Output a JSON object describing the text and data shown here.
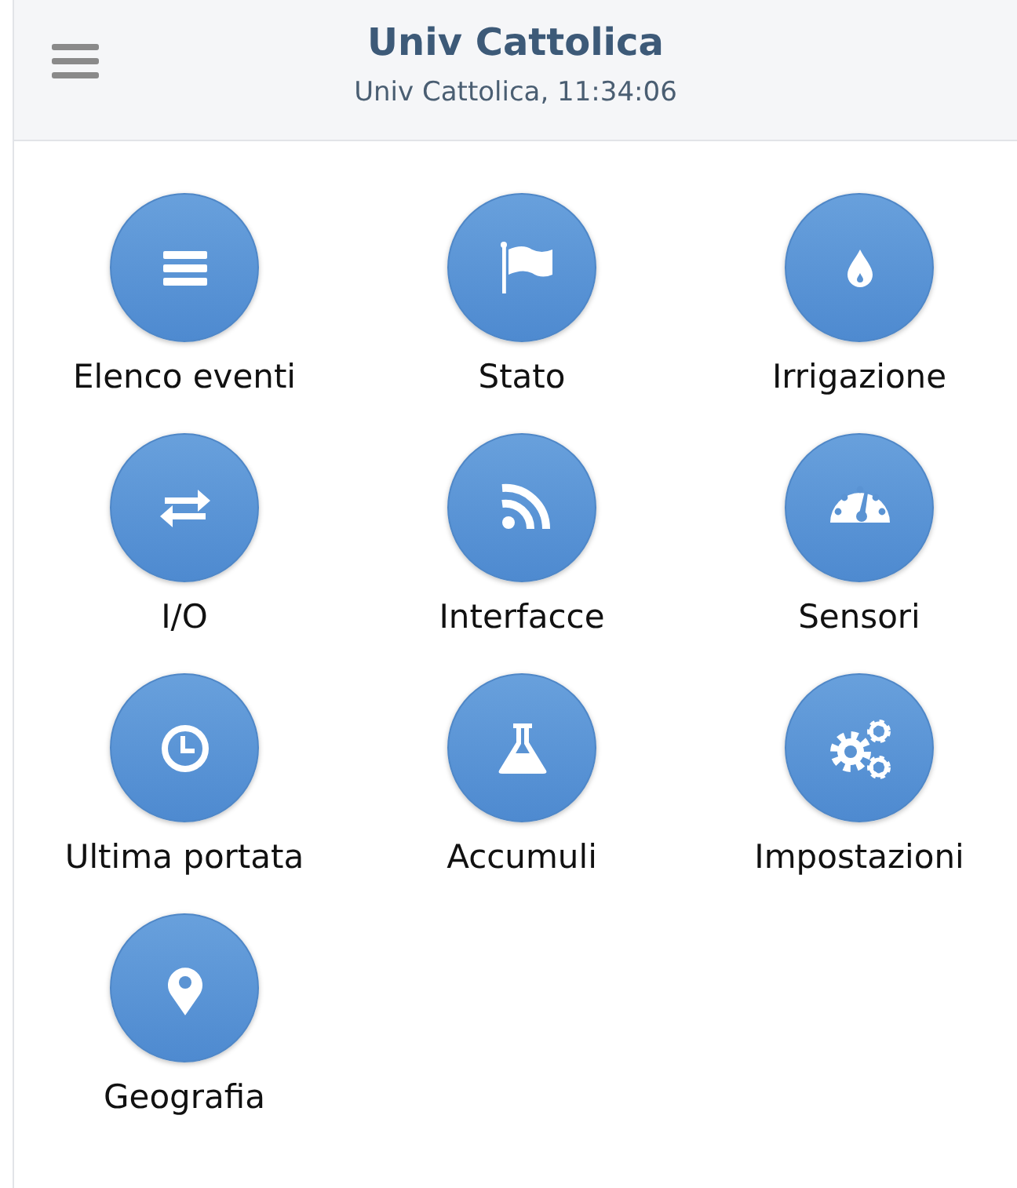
{
  "header": {
    "title": "Univ Cattolica",
    "subtitle": "Univ Cattolica, 11:34:06"
  },
  "items": [
    {
      "label": "Elenco eventi"
    },
    {
      "label": "Stato"
    },
    {
      "label": "Irrigazione"
    },
    {
      "label": "I/O"
    },
    {
      "label": "Interfacce"
    },
    {
      "label": "Sensori"
    },
    {
      "label": "Ultima portata"
    },
    {
      "label": "Accumuli"
    },
    {
      "label": "Impostazioni"
    },
    {
      "label": "Geografia"
    }
  ]
}
